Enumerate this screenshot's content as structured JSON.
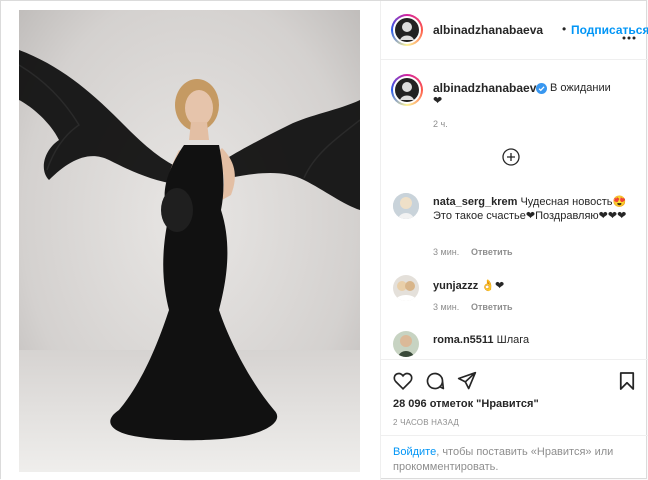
{
  "header": {
    "username": "albinadzhanabaeva",
    "separator": "•",
    "follow_label": "Подписаться",
    "more_icon": "more-horizontal-icon"
  },
  "caption": {
    "username": "albinadzhanabaeva",
    "text": "В ожидании",
    "heart": "❤",
    "time": "2 ч."
  },
  "load_more_icon": "plus-circle-icon",
  "comments": [
    {
      "username": "nata_serg_krem",
      "text": "Чудесная новость😍 Это такое счастье❤Поздравляю❤❤❤",
      "time": "3 мин.",
      "reply_label": "Ответить"
    },
    {
      "username": "yunjazzz",
      "text": "👌❤",
      "time": "3 мин.",
      "reply_label": "Ответить"
    },
    {
      "username": "roma.n5511",
      "text": "Шлага"
    }
  ],
  "actions": {
    "like_icon": "heart-icon",
    "comment_icon": "comment-icon",
    "share_icon": "share-icon",
    "save_icon": "bookmark-icon"
  },
  "likes": {
    "text": "28 096 отметок \"Нравится\""
  },
  "timestamp": "2 ЧАСОВ НАЗАД",
  "login_prompt": {
    "link": "Войдите",
    "text": ", чтобы поставить «Нравится» или прокомментировать."
  },
  "colors": {
    "link_blue": "#0095f6",
    "verified_blue": "#3897f0",
    "muted": "#8e8e8e",
    "dress": "#111111"
  }
}
